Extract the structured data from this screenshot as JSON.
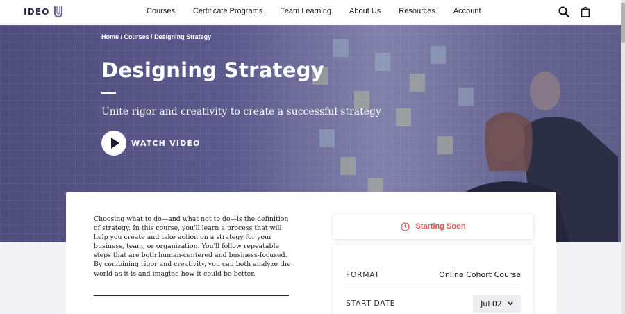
{
  "header": {
    "logo_text": "IDEO",
    "nav": [
      {
        "label": "Courses"
      },
      {
        "label": "Certificate Programs"
      },
      {
        "label": "Team Learning"
      },
      {
        "label": "About Us"
      },
      {
        "label": "Resources"
      },
      {
        "label": "Account"
      }
    ],
    "icons": {
      "search": "search-icon",
      "cart": "cart-icon"
    }
  },
  "hero": {
    "breadcrumb": [
      "Home",
      "Courses",
      "Designing Strategy"
    ],
    "breadcrumb_separator": " / ",
    "title": "Designing Strategy",
    "subtitle": "Unite rigor and creativity to create a successful strategy",
    "watch_label": "WATCH VIDEO"
  },
  "course": {
    "description": "Choosing what to do—and what not to do—is the definition of strategy. In this course, you'll learn a process that will help you create and take action on a strategy for your business, team, or organization. You'll follow repeatable steps that are both human-centered and business-focused. By combining rigor and creativity, you can both analyze the world as it is and imagine how it could be better.",
    "status": "Starting Soon",
    "format_label": "FORMAT",
    "format_value": "Online Cohort Course",
    "start_date_label": "START DATE",
    "start_date_value": "Jul 02"
  },
  "colors": {
    "accent": "#e05050",
    "logo_purple": "#6b5fa8",
    "hero_overlay": "#5c5b8d"
  }
}
